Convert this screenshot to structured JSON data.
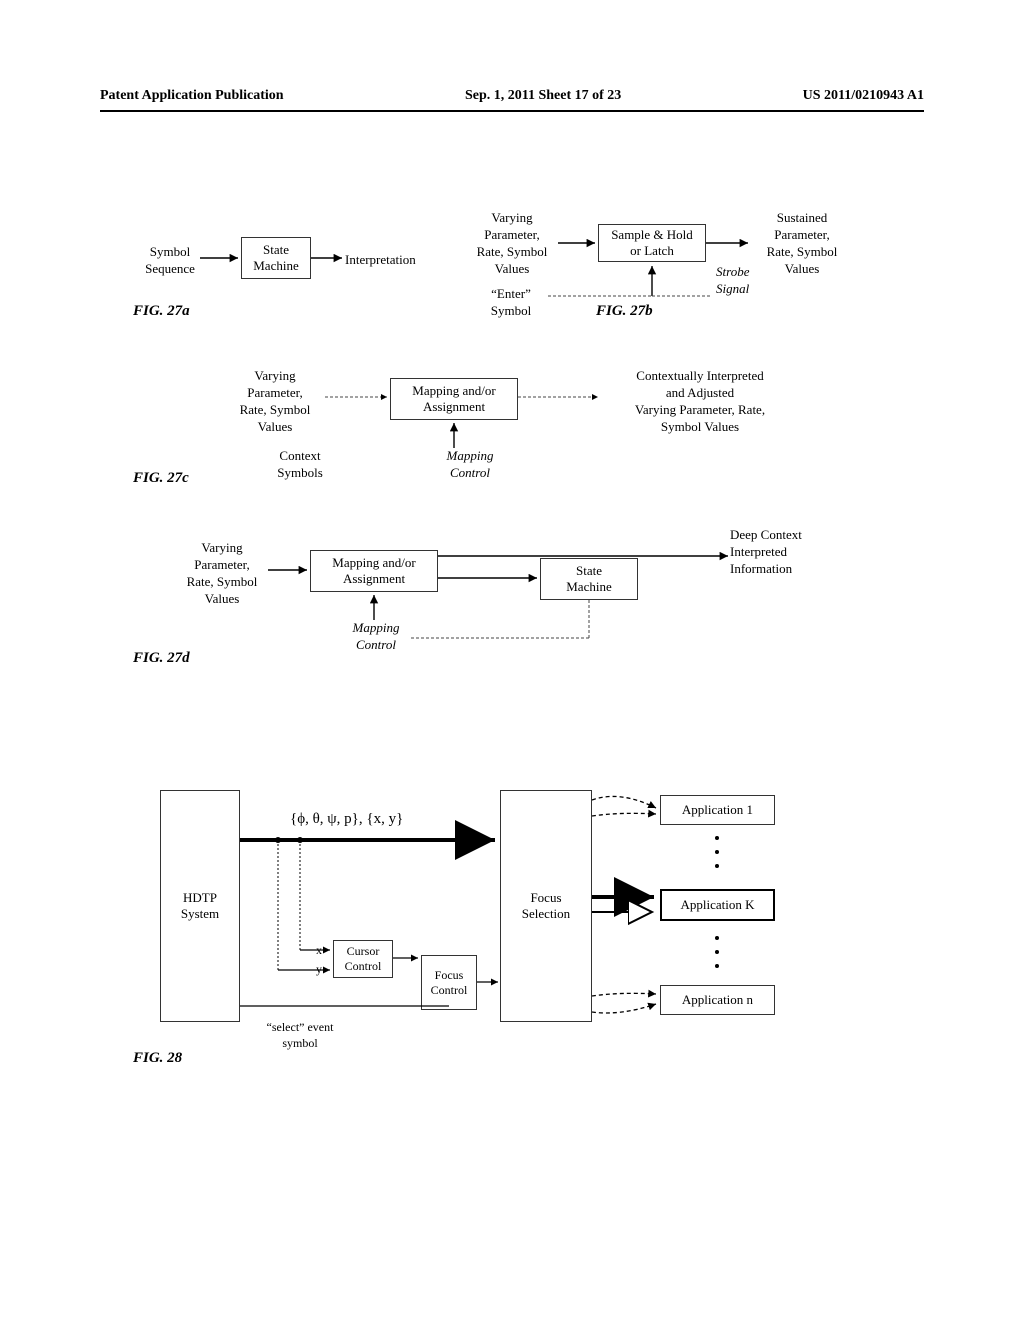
{
  "header": {
    "left": "Patent Application Publication",
    "center": "Sep. 1, 2011  Sheet 17 of 23",
    "right": "US 2011/0210943 A1"
  },
  "fig27a": {
    "label": "FIG. 27a",
    "input": "Symbol\nSequence",
    "box": "State\nMachine",
    "output": "Interpretation"
  },
  "fig27b": {
    "label": "FIG. 27b",
    "input": "Varying\nParameter,\nRate, Symbol\nValues",
    "box": "Sample & Hold\nor Latch",
    "output": "Sustained\nParameter,\nRate, Symbol\nValues",
    "strobe": "Strobe\nSignal",
    "enter": "“Enter”\nSymbol"
  },
  "fig27c": {
    "label": "FIG. 27c",
    "input": "Varying\nParameter,\nRate, Symbol\nValues",
    "box": "Mapping and/or\nAssignment",
    "output": "Contextually Interpreted\nand Adjusted\nVarying Parameter, Rate,\nSymbol Values",
    "ctx": "Context\nSymbols",
    "map": "Mapping\nControl"
  },
  "fig27d": {
    "label": "FIG. 27d",
    "input": "Varying\nParameter,\nRate, Symbol\nValues",
    "box1": "Mapping and/or\nAssignment",
    "box2": "State\nMachine",
    "output": "Deep Context\nInterpreted\nInformation",
    "map": "Mapping\nControl"
  },
  "fig28": {
    "label": "FIG. 28",
    "hdtp": "HDTP\nSystem",
    "params": "{ϕ, θ, ψ, p}, {x, y}",
    "focus_sel": "Focus\nSelection",
    "cursor": "Cursor\nControl",
    "focus_ctrl": "Focus\nControl",
    "x": "x",
    "y": "y",
    "sel": "“select” event\nsymbol",
    "app1": "Application 1",
    "appk": "Application K",
    "appn": "Application n"
  }
}
